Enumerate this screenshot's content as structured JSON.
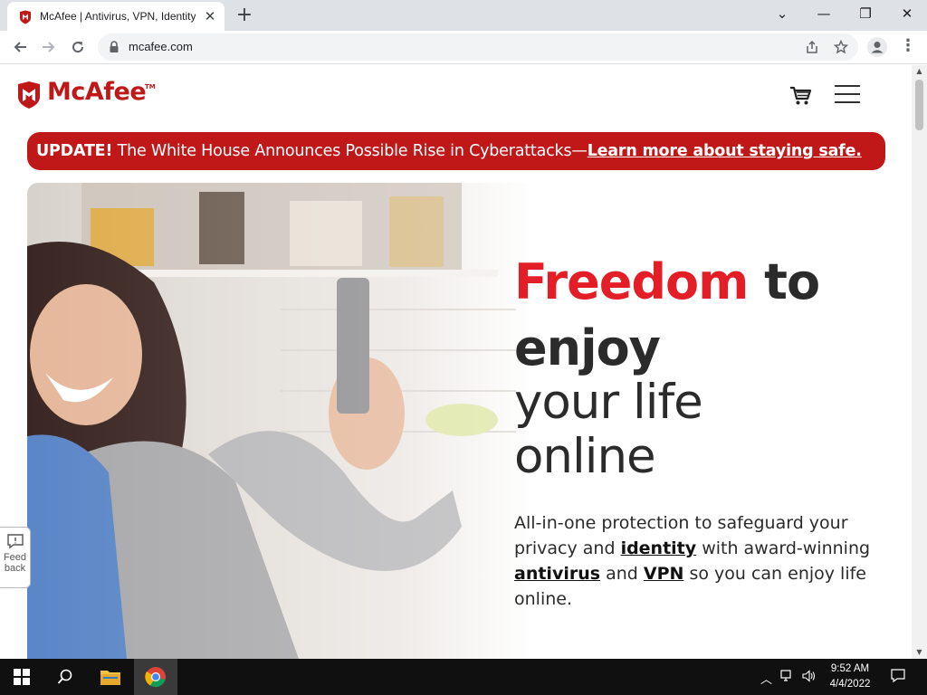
{
  "browser": {
    "tab_title": "McAfee | Antivirus, VPN, Identity",
    "tab_close": "✕",
    "new_tab": "+",
    "url": "mcafee.com",
    "window_controls": {
      "dropdown": "⌄",
      "minimize": "—",
      "restore": "❐",
      "close": "✕"
    }
  },
  "site": {
    "logo_text": "McAfee",
    "logo_tm": "TM",
    "brand_color": "#c01818",
    "alert": {
      "strong": "UPDATE!",
      "text": " The White House Announces Possible Rise in Cyberattacks—",
      "link": "Learn more about staying safe."
    },
    "hero": {
      "headline_red": "Freedom",
      "headline_to": " to",
      "headline_enjoy": "enjoy",
      "headline_line3": "your life",
      "headline_line4": "online",
      "copy_1": "All-in-one protection to safeguard your privacy and ",
      "copy_link_identity": "identity",
      "copy_2": " with award-winning ",
      "copy_link_antivirus": "antivirus",
      "copy_3": " and ",
      "copy_link_vpn": "VPN",
      "copy_4": " so you can enjoy life online."
    },
    "feedback_label_1": "Feed",
    "feedback_label_2": "back"
  },
  "taskbar": {
    "time": "9:52 AM",
    "date": "4/4/2022"
  }
}
